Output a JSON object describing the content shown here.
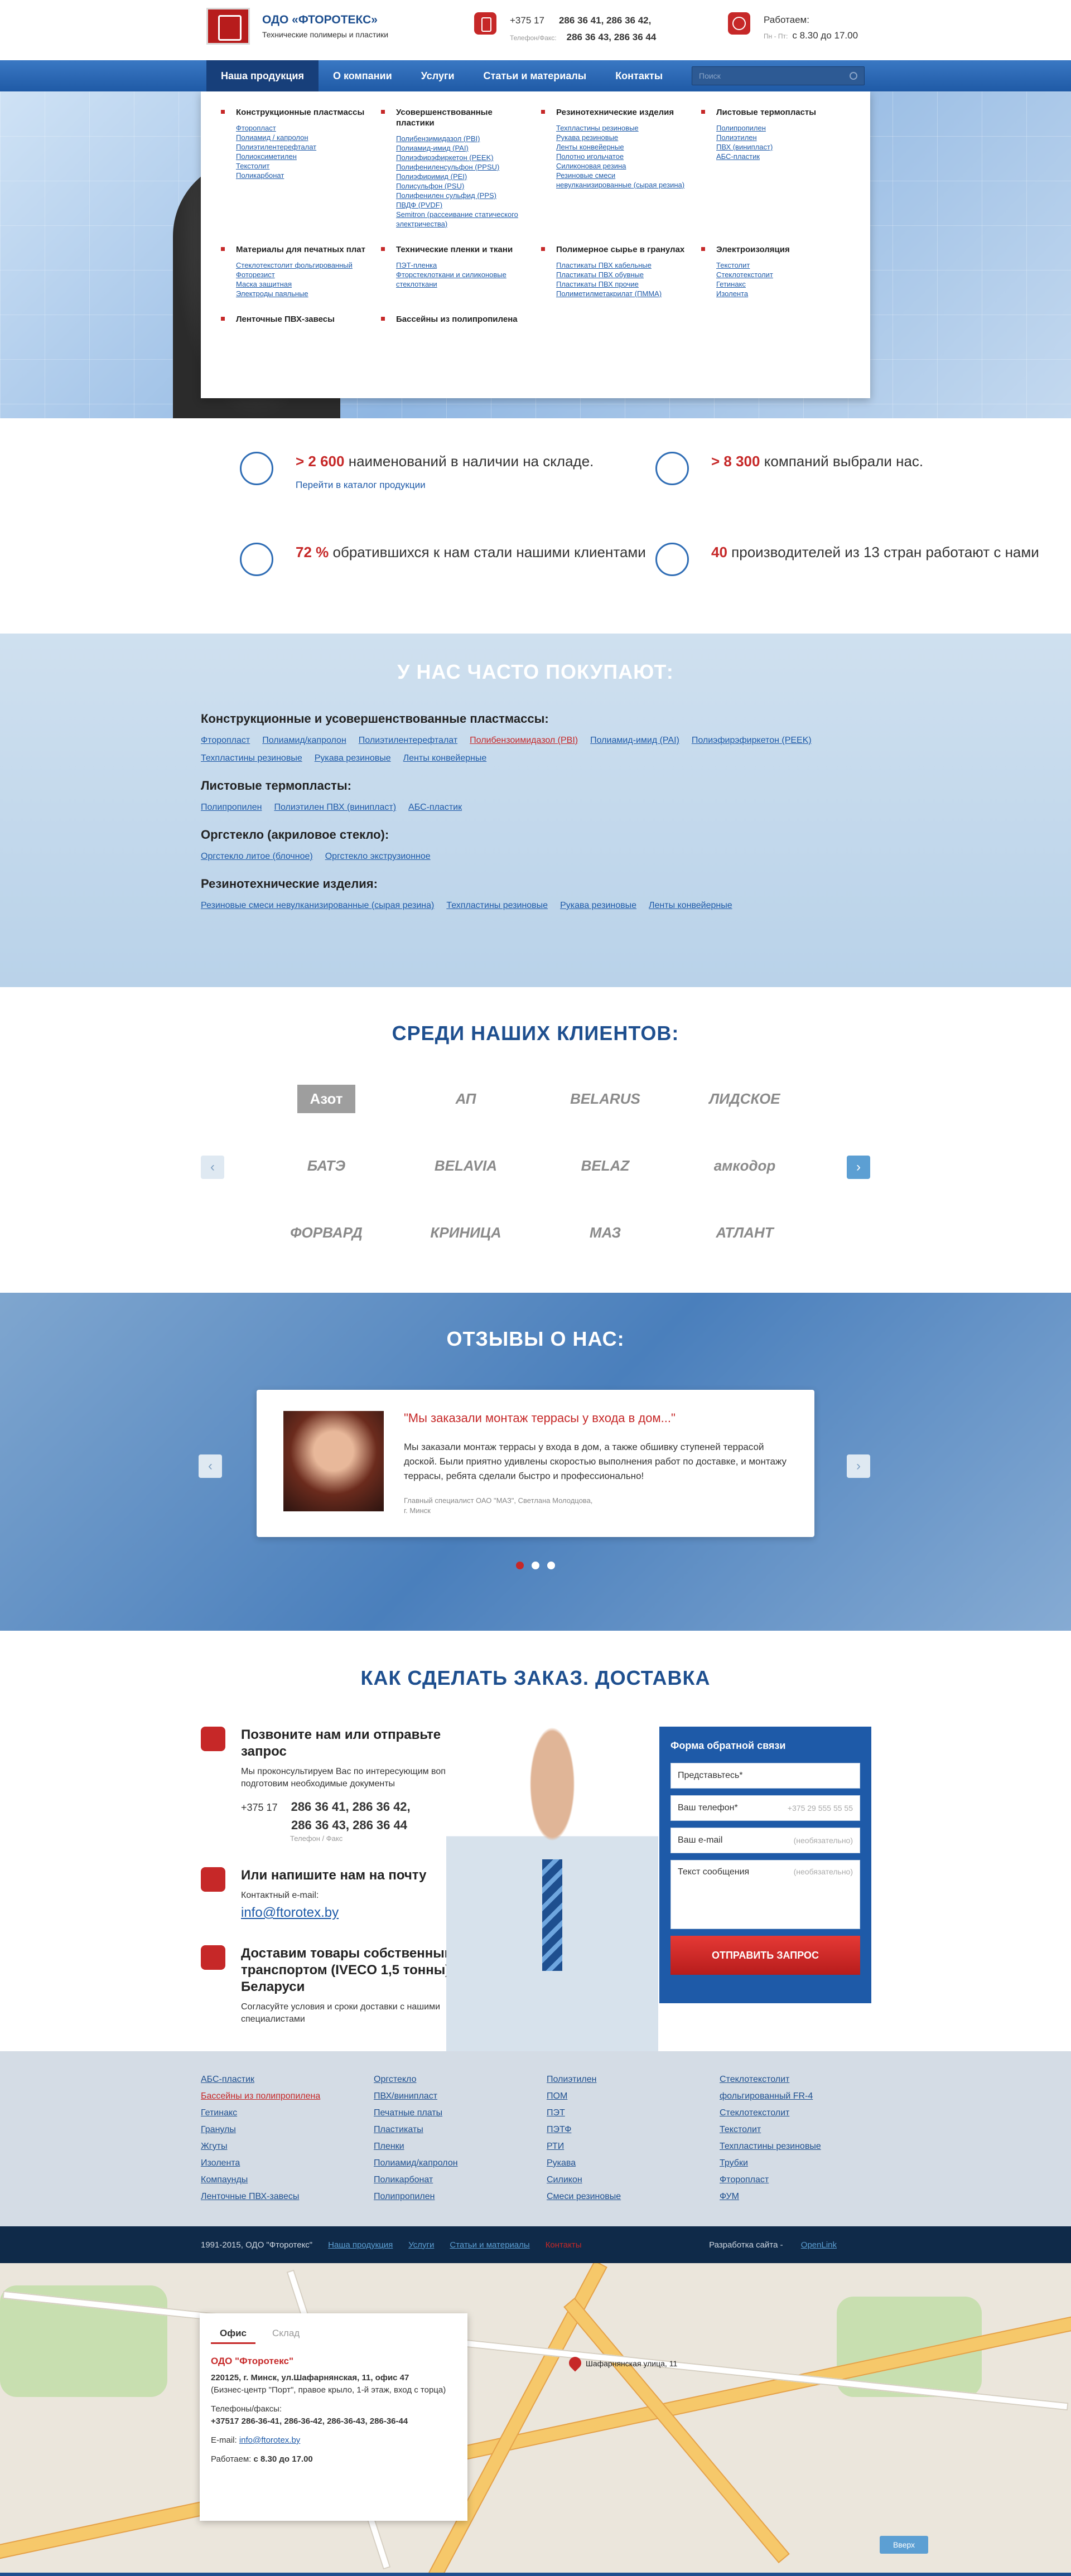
{
  "header": {
    "company": "ОДО «ФТОРОТЕКС»",
    "tagline": "Технические полимеры и пластики",
    "phone_prefix": "+375 17",
    "phone_line1": "286 36 41, 286 36 42,",
    "phone_line2": "286 36 43, 286 36 44",
    "phone_label": "Телефон/Факс:",
    "hours_title": "Работаем:",
    "hours_days": "Пн - Пт:",
    "hours_value": "с 8.30 до 17.00"
  },
  "nav": {
    "items": [
      "Наша продукция",
      "О компании",
      "Услуги",
      "Статьи и материалы",
      "Контакты"
    ],
    "search_placeholder": "Поиск"
  },
  "megamenu": [
    {
      "title": "Конструкционные пластмассы",
      "items": [
        "Фторопласт",
        "Полиамид / капролон",
        "Полиэтилентерефталат",
        "Полиоксиметилен",
        "Текстолит",
        "Поликарбонат"
      ]
    },
    {
      "title": "Усовершенствованные пластики",
      "items": [
        "Полибензимидазол (PBI)",
        "Полиамид-имид (PAI)",
        "Полиэфирэфиркетон (PEEK)",
        "Полифениленсульфон (PPSU)",
        "Полиэфиримид (PEI)",
        "Полисульфон (PSU)",
        "Полифенилен сульфид (PPS)",
        "ПВДФ (PVDF)",
        "Semitron (рассеивание статического электричества)"
      ]
    },
    {
      "title": "Резинотехнические изделия",
      "items": [
        "Техпластины резиновые",
        "Рукава резиновые",
        "Ленты конвейерные",
        "Полотно игольчатое",
        "Силиконовая резина",
        "Резиновые смеси невулканизированные (сырая резина)"
      ]
    },
    {
      "title": "Листовые термопласты",
      "items": [
        "Полипропилен",
        "Полиэтилен",
        "ПВХ (винипласт)",
        "АБС-пластик"
      ]
    },
    {
      "title": "Материалы для печатных плат",
      "items": [
        "Стеклотекстолит фольгированный",
        "Фоторезист",
        "Маска защитная",
        "Электроды паяльные"
      ]
    },
    {
      "title": "Технические пленки и ткани",
      "items": [
        "ПЭТ-пленка",
        "Фторстеклоткани и силиконовые стеклоткани"
      ]
    },
    {
      "title": "Полимерное сырье в гранулах",
      "items": [
        "Пластикаты ПВХ кабельные",
        "Пластикаты ПВХ обувные",
        "Пластикаты ПВХ прочие",
        "Полиметилметакрилат (ПММА)"
      ]
    },
    {
      "title": "Электроизоляция",
      "items": [
        "Текстолит",
        "Стеклотекстолит",
        "Гетинакс",
        "Изолента"
      ]
    },
    {
      "title": "Ленточные ПВХ-завесы",
      "items": []
    },
    {
      "title": "Бассейны из полипропилена",
      "items": []
    }
  ],
  "stats": [
    {
      "value": "> 2 600",
      "text": "наименований в наличии на складе.",
      "link": "Перейти в каталог продукции"
    },
    {
      "value": "> 8 300",
      "text": "компаний выбрали нас.",
      "link": ""
    },
    {
      "value": "72 %",
      "text": "обратившихся к нам стали нашими клиентами",
      "link": ""
    },
    {
      "value": "40",
      "text": "производителей из 13 стран работают с нами",
      "link": ""
    }
  ],
  "often": {
    "title": "У НАС ЧАСТО ПОКУПАЮТ:",
    "groups": [
      {
        "title": "Конструкционные и усовершенствованные пластмассы:",
        "links": [
          "Фторопласт",
          "Полиамид/капролон",
          "Полиэтилентерефталат",
          "Полибензоимидазол (PBI)",
          "Полиамид-имид (PAI)",
          "Полиэфирэфиркетон (PEEK)",
          "Техпластины резиновые",
          "Рукава резиновые",
          "Ленты конвейерные"
        ],
        "hot": 3
      },
      {
        "title": "Листовые термопласты:",
        "links": [
          "Полипропилен",
          "Полиэтилен ПВХ (винипласт)",
          "АБС-пластик"
        ],
        "hot": -1
      },
      {
        "title": "Оргстекло (акриловое стекло):",
        "links": [
          "Оргстекло литое (блочное)",
          "Оргстекло экструзионное"
        ],
        "hot": -1
      },
      {
        "title": "Резинотехнические изделия:",
        "links": [
          "Резиновые смеси невулканизированные (сырая резина)",
          "Техпластины резиновые",
          "Рукава резиновые",
          "Ленты конвейерные"
        ],
        "hot": -1
      }
    ]
  },
  "clients": {
    "title": "СРЕДИ НАШИХ КЛИЕНТОВ:",
    "logos": [
      "Азот",
      "АП",
      "BELARUS",
      "ЛИДСКОЕ",
      "БАТЭ",
      "BELAVIA",
      "BELAZ",
      "амкодор",
      "ФОРВАРД",
      "КРИНИЦА",
      "МАЗ",
      "АТЛАНТ"
    ]
  },
  "reviews": {
    "title": "ОТЗЫВЫ О НАС:",
    "heading": "\"Мы заказали монтаж террасы у входа в дом...\"",
    "body": "Мы заказали монтаж террасы у входа в дом, а также обшивку ступеней террасой доской. Были приятно удивлены скоростью выполнения работ по доставке, и монтажу террасы, ребята сделали быстро и профессионально!",
    "sign1": "Главный специалист ОАО \"МАЗ\", Светлана Молодцова,",
    "sign2": "г. Минск"
  },
  "order": {
    "title": "КАК СДЕЛАТЬ ЗАКАЗ. ДОСТАВКА",
    "s1_title": "Позвоните нам или отправьте запрос",
    "s1_text": "Мы проконсультируем Вас по интересующим вопросам и подготовим необходимые документы",
    "s1_prefix": "+375 17",
    "s1_phone1": "286 36 41, 286 36 42,",
    "s1_phone2": "286 36 43, 286 36 44",
    "s1_label": "Телефон / Факс",
    "s2_title": "Или напишите нам на почту",
    "s2_text": "Контактный e-mail:",
    "s2_mail": "info@ftorotex.by",
    "s3_title": "Доставим товары собственным транспортом (IVECO 1,5 тонны) по Беларуси",
    "s3_text": "Согласуйте условия и сроки доставки с нашими специалистами"
  },
  "form": {
    "title": "Форма обратной связи",
    "name": "Представьтесь*",
    "phone": "Ваш телефон*",
    "phone_ph": "+375 29 555 55 55",
    "email": "Ваш e-mail",
    "email_ph": "(необязательно)",
    "message": "Текст сообщения",
    "message_ph": "(необязательно)",
    "submit": "ОТПРАВИТЬ ЗАПРОС"
  },
  "footer_links": [
    [
      "АБС-пластик",
      "Бассейны из полипропилена",
      "Гетинакс",
      "Гранулы",
      "Жгуты",
      "Изолента",
      "Компаунды",
      "Ленточные ПВХ-завесы"
    ],
    [
      "Оргстекло",
      "ПВХ/винипласт",
      "Печатные платы",
      "Пластикаты",
      "Пленки",
      "Полиамид/капролон",
      "Поликарбонат",
      "Полипропилен"
    ],
    [
      "Полиэтилен",
      "ПОМ",
      "ПЭТ",
      "ПЭТФ",
      "РТИ",
      "Рукава",
      "Силикон",
      "Смеси резиновые"
    ],
    [
      "Стеклотекстолит",
      "фольгированный FR-4",
      "Стеклотекстолит",
      "Текстолит",
      "Техпластины резиновые",
      "Трубки",
      "Фторопласт",
      "ФУМ"
    ]
  ],
  "footer_bar": {
    "copyright": "1991-2015, ОДО \"Фторотекс\"",
    "links": [
      "Наша продукция",
      "Услуги",
      "Статьи и материалы",
      "Контакты"
    ],
    "dev": "Разработка сайта - ",
    "dev_link": "OpenLink"
  },
  "map": {
    "tabs": [
      "Офис",
      "Склад"
    ],
    "company": "ОДО \"Фторотекс\"",
    "address": "220125, г. Минск, ул.Шафарнянская, 11, офис 47",
    "address_note": "(Бизнес-центр \"Порт\", правое крыло, 1-й этаж, вход с торца)",
    "phones_label": "Телефоны/факсы:",
    "phones": "+37517 286-36-41, 286-36-42, 286-36-43, 286-36-44",
    "email_label": "E-mail:",
    "email": "info@ftorotex.by",
    "hours_label": "Работаем:",
    "hours": "с 8.30 до 17.00",
    "pin_label": "Шафарнянская улица, 11",
    "up": "Вверх"
  }
}
